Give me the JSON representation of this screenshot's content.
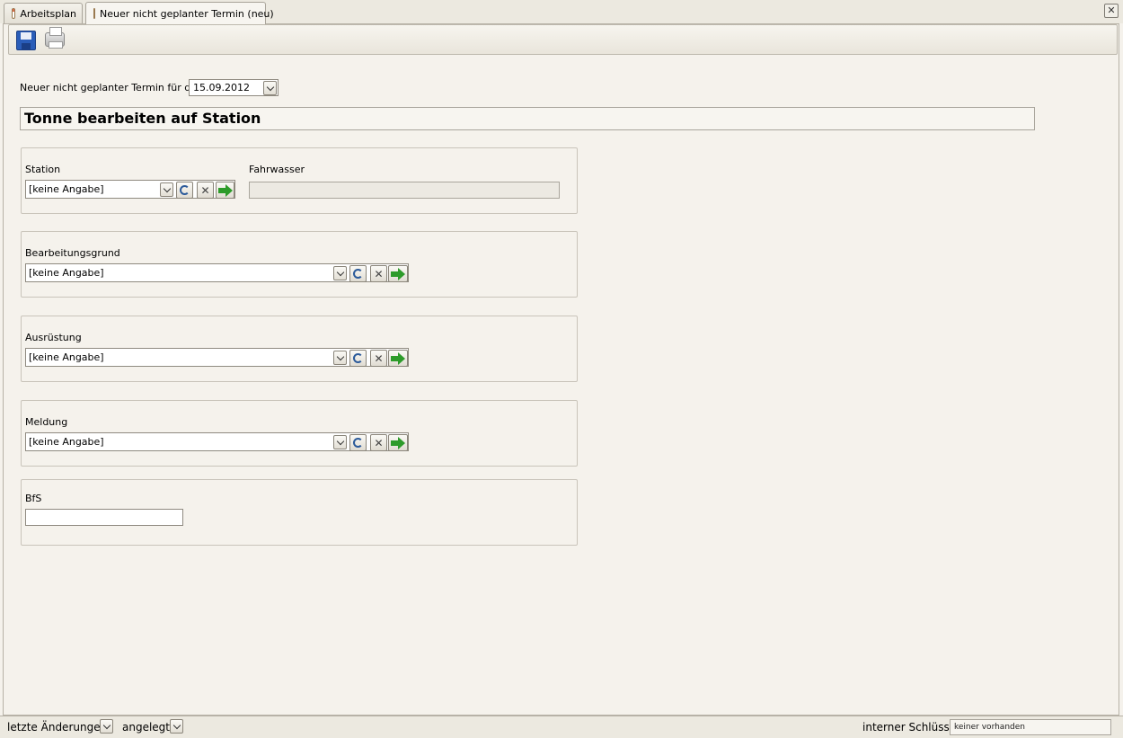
{
  "tabs": [
    {
      "label": "Arbeitsplan"
    },
    {
      "label": "Neuer nicht geplanter Termin (neu)"
    }
  ],
  "date_row": {
    "label": "Neuer nicht geplanter Termin für den",
    "value": "15.09.2012"
  },
  "header": {
    "title": "Tonne bearbeiten auf Station"
  },
  "station_group": {
    "station_label": "Station",
    "station_value": "[keine Angabe]",
    "fahrwasser_label": "Fahrwasser",
    "fahrwasser_value": ""
  },
  "bearbeitungsgrund_group": {
    "label": "Bearbeitungsgrund",
    "value": "[keine Angabe]"
  },
  "ausruestung_group": {
    "label": "Ausrüstung",
    "value": "[keine Angabe]"
  },
  "meldung_group": {
    "label": "Meldung",
    "value": "[keine Angabe]"
  },
  "bfs_group": {
    "label": "BfS",
    "value": ""
  },
  "statusbar": {
    "last_changes_label": "letzte Änderungen",
    "created_label": "angelegt",
    "internal_key_label": "interner Schlüssel",
    "internal_key_value": "keiner vorhanden"
  },
  "icons": {
    "save": "floppy-disk-icon",
    "print": "printer-icon",
    "close": "close-icon",
    "dropdown": "chevron-down-icon",
    "refresh": "refresh-icon",
    "clear": "clear-x-icon",
    "goto": "green-arrow-right-icon"
  }
}
